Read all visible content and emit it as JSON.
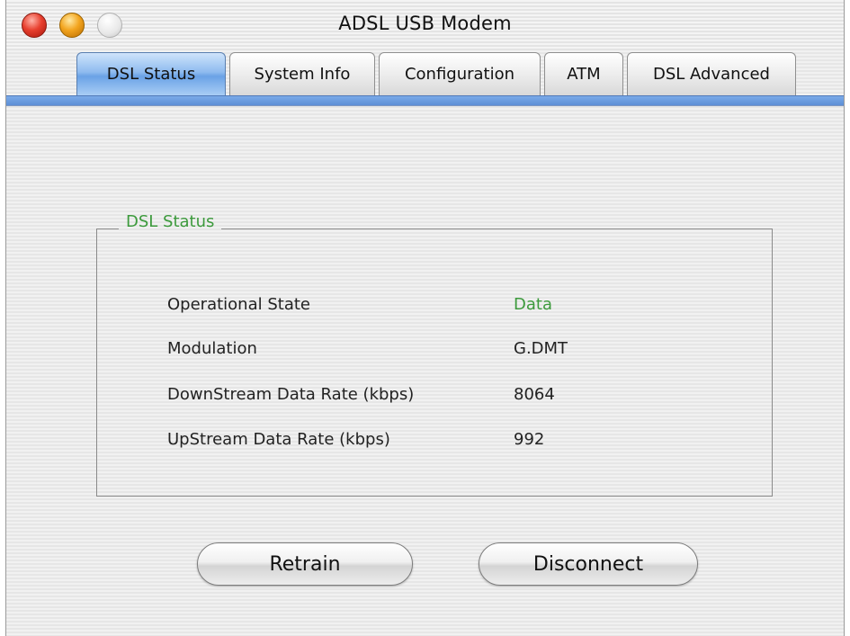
{
  "window": {
    "title": "ADSL USB Modem"
  },
  "tabs": [
    {
      "label": "DSL Status",
      "active": true
    },
    {
      "label": "System Info",
      "active": false
    },
    {
      "label": "Configuration",
      "active": false
    },
    {
      "label": "ATM",
      "active": false
    },
    {
      "label": "DSL Advanced",
      "active": false
    }
  ],
  "dsl_status": {
    "group_title": "DSL Status",
    "rows": [
      {
        "label": "Operational State",
        "value": "Data"
      },
      {
        "label": "Modulation",
        "value": "G.DMT"
      },
      {
        "label": "DownStream Data Rate (kbps)",
        "value": "8064"
      },
      {
        "label": "UpStream Data Rate (kbps)",
        "value": "992"
      }
    ]
  },
  "buttons": {
    "retrain": "Retrain",
    "disconnect": "Disconnect"
  },
  "colors": {
    "accent_tab": "#6aa2e6",
    "status_green": "#3c9a3c"
  }
}
